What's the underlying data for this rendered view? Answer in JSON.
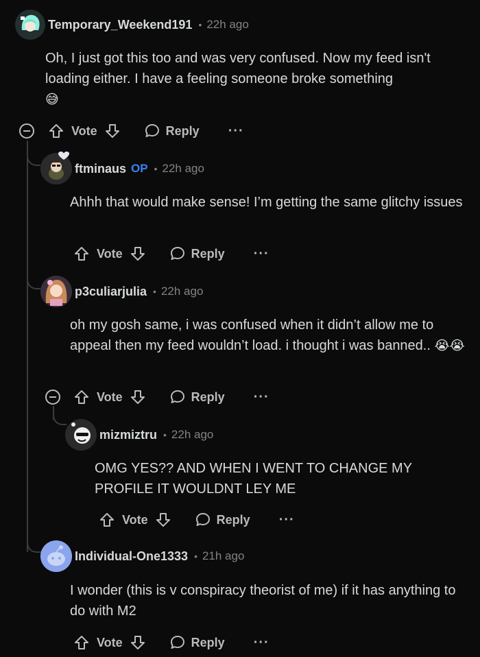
{
  "comments": [
    {
      "username": "Temporary_Weekend191",
      "time": "22h ago",
      "text": "Oh, I just got this too and was very confused. Now my feed isn't loading either. I have a feeling someone broke something",
      "emoji": "😅",
      "vote_label": "Vote",
      "reply_label": "Reply",
      "more_label": "···"
    },
    {
      "username": "ftminaus",
      "op_label": "OP",
      "time": "22h ago",
      "text": "Ahhh that would make sense! I’m getting the same glitchy issues",
      "vote_label": "Vote",
      "reply_label": "Reply",
      "more_label": "···"
    },
    {
      "username": "p3culiarjulia",
      "time": "22h ago",
      "text": "oh my gosh same, i was confused when it didn’t allow me to appeal then my feed wouldn’t load. i thought i was banned..",
      "emoji": "😭😭",
      "vote_label": "Vote",
      "reply_label": "Reply",
      "more_label": "···"
    },
    {
      "username": "mizmiztru",
      "time": "22h ago",
      "text": "OMG YES?? AND WHEN I WENT TO CHANGE MY PROFILE IT WOULDNT LEY ME",
      "vote_label": "Vote",
      "reply_label": "Reply",
      "more_label": "···"
    },
    {
      "username": "Individual-One1333",
      "time": "21h ago",
      "text": "I wonder (this is v conspiracy theorist of me) if it has anything to do with M2",
      "vote_label": "Vote",
      "reply_label": "Reply",
      "more_label": "···"
    }
  ],
  "separator": "•",
  "icons": {
    "upvote": "arrow-up-icon",
    "downvote": "arrow-down-icon",
    "reply": "speech-bubble-icon",
    "collapse": "collapse-minus-icon",
    "more": "ellipsis-icon"
  },
  "colors": {
    "background": "#0b0b0b",
    "text": "#d7dadc",
    "meta": "#818384",
    "op": "#3b82f6",
    "thread": "#3a3d3f"
  }
}
